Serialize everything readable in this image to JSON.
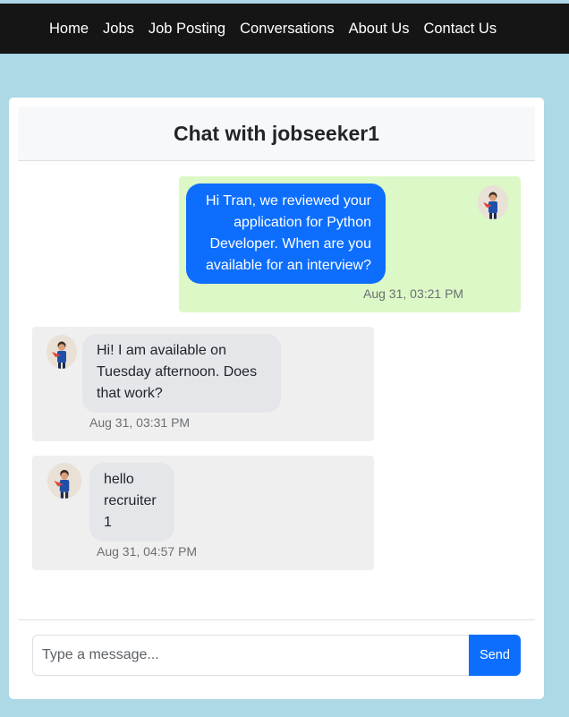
{
  "nav": {
    "items": [
      "Home",
      "Jobs",
      "Job Posting",
      "Conversations",
      "About Us",
      "Contact Us"
    ]
  },
  "chat": {
    "title": "Chat with jobseeker1",
    "messages": [
      {
        "direction": "sent",
        "lines": [
          "Hi Tran, we reviewed your",
          "application for Python",
          "Developer. When are you",
          "available for an interview?"
        ],
        "time": "Aug 31, 03:21 PM",
        "avatar_icon": "user-avatar-icon"
      },
      {
        "direction": "received",
        "lines": [
          "Hi! I am available on",
          "Tuesday afternoon. Does",
          "that work?"
        ],
        "time": "Aug 31, 03:31 PM",
        "avatar_icon": "user-avatar-icon"
      },
      {
        "direction": "received",
        "lines": [
          "hello",
          "recruiter",
          "1"
        ],
        "time": "Aug 31, 04:57 PM",
        "avatar_icon": "user-avatar-icon"
      }
    ]
  },
  "composer": {
    "placeholder": "Type a message...",
    "send_label": "Send"
  },
  "colors": {
    "page_bg": "#add8e6",
    "navbar_bg": "#151515",
    "sent_bg": "#dcf8c6",
    "received_bg": "#efefef",
    "accent": "#0d6efd"
  }
}
